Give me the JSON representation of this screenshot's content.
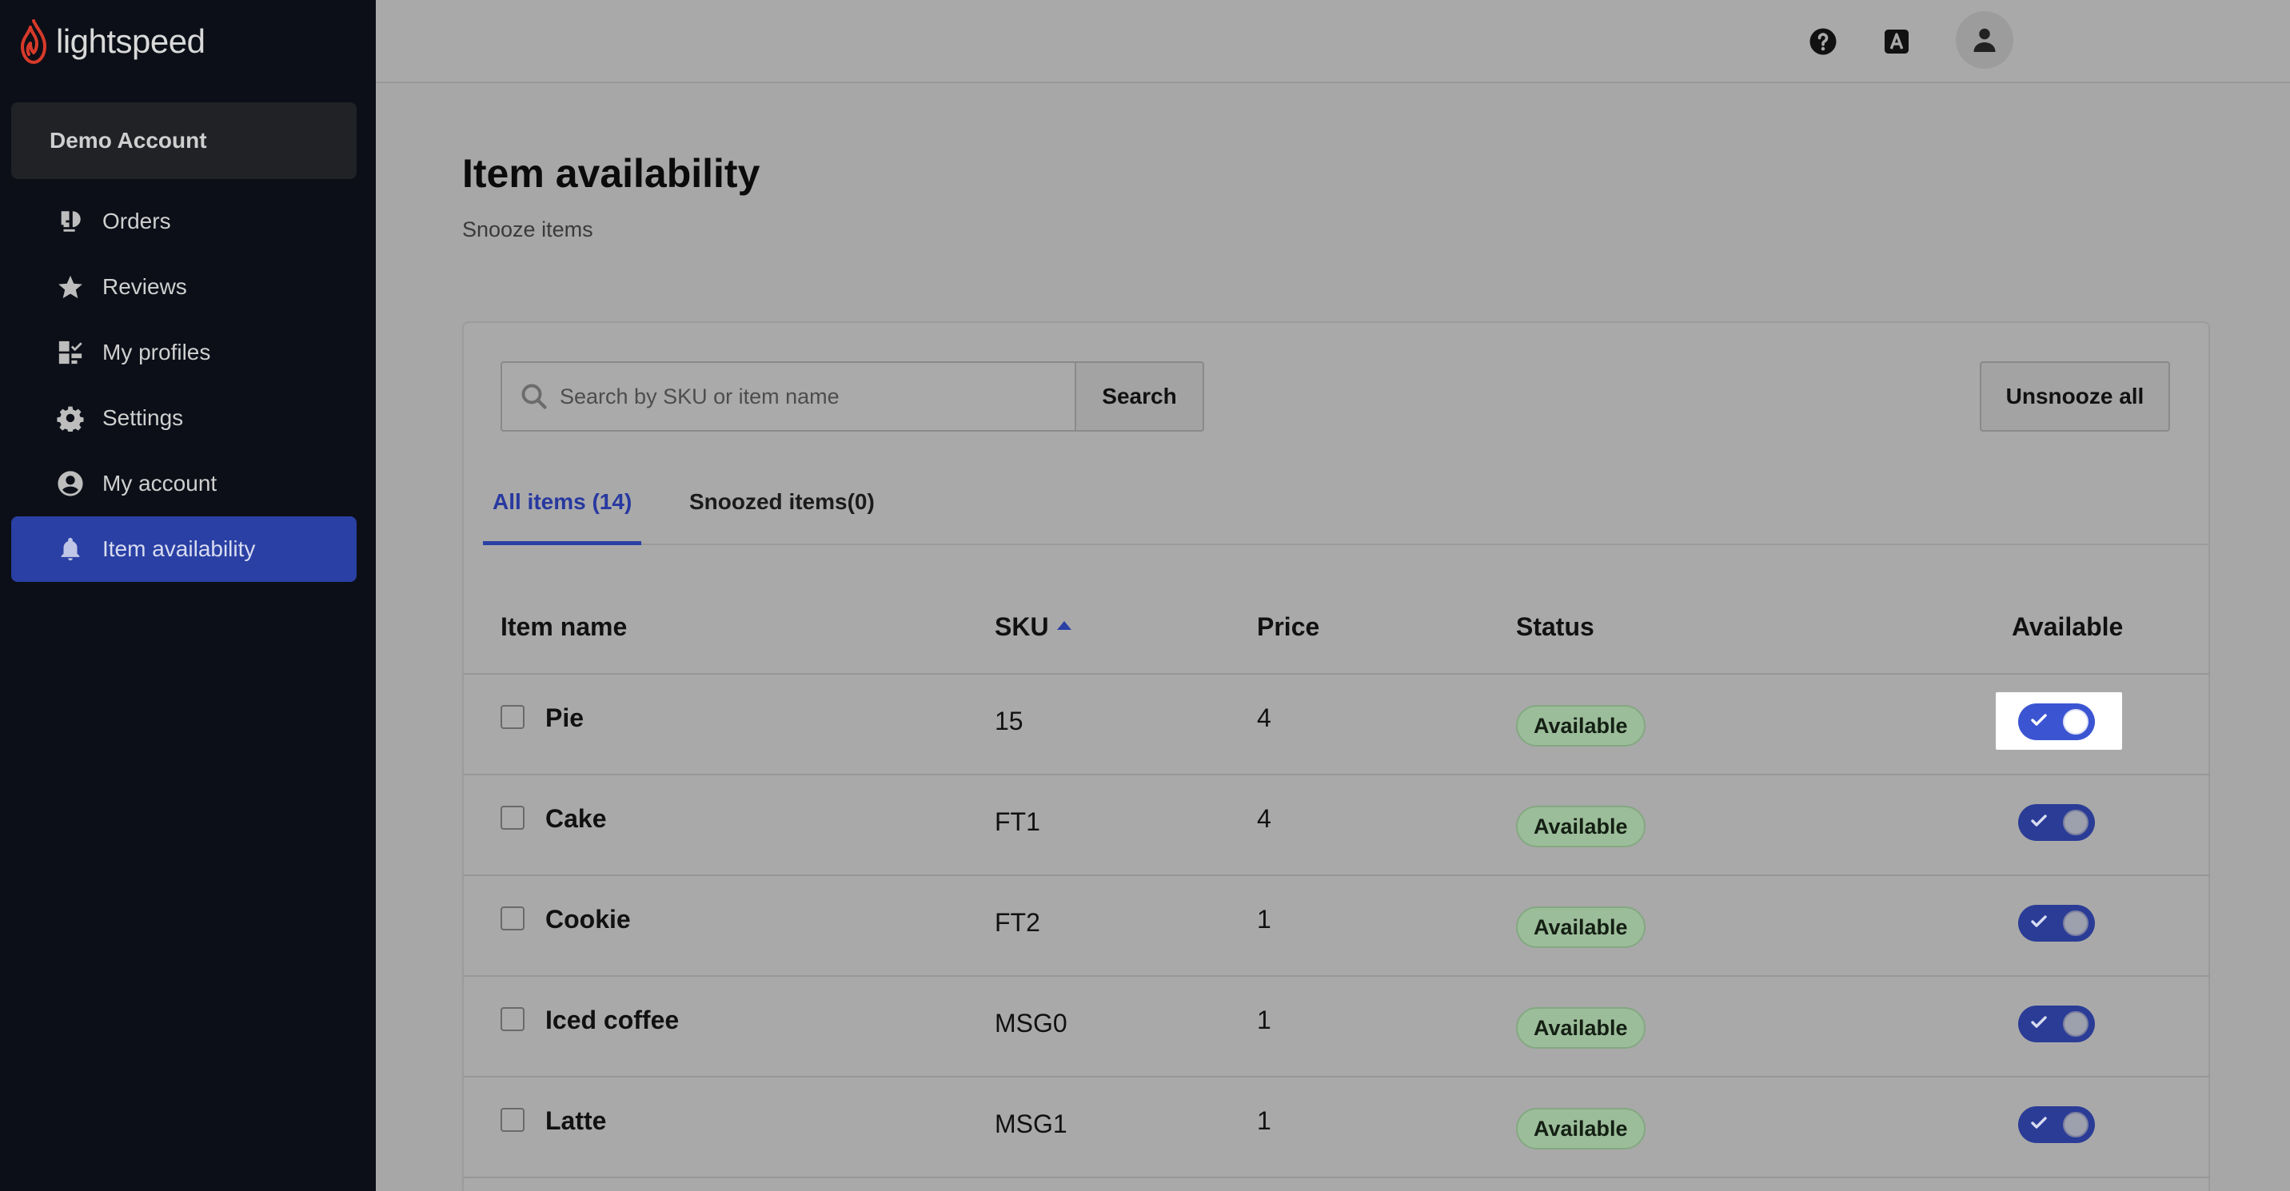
{
  "brand": {
    "name": "lightspeed",
    "accent": "#2a40a4",
    "flame_color": "#d83a2a"
  },
  "sidebar": {
    "account": "Demo Account",
    "items": [
      {
        "label": "Orders",
        "icon": "orders-icon",
        "active": false
      },
      {
        "label": "Reviews",
        "icon": "star-icon",
        "active": false
      },
      {
        "label": "My profiles",
        "icon": "profiles-icon",
        "active": false
      },
      {
        "label": "Settings",
        "icon": "gear-icon",
        "active": false
      },
      {
        "label": "My account",
        "icon": "user-circle-icon",
        "active": false
      },
      {
        "label": "Item availability",
        "icon": "bell-icon",
        "active": true
      }
    ]
  },
  "header": {
    "title": "Item availability",
    "subtitle": "Snooze items"
  },
  "toolbar": {
    "search_placeholder": "Search by SKU or item name",
    "search_label": "Search",
    "unsnooze_label": "Unsnooze all"
  },
  "tabs": [
    {
      "label": "All items (14)",
      "active": true
    },
    {
      "label": "Snoozed items(0)",
      "active": false
    }
  ],
  "table": {
    "columns": {
      "name": "Item name",
      "sku": "SKU",
      "price": "Price",
      "status": "Status",
      "available": "Available"
    },
    "rows": [
      {
        "name": "Pie",
        "sku": "15",
        "price": "4",
        "status": "Available",
        "available": true
      },
      {
        "name": "Cake",
        "sku": "FT1",
        "price": "4",
        "status": "Available",
        "available": true
      },
      {
        "name": "Cookie",
        "sku": "FT2",
        "price": "1",
        "status": "Available",
        "available": true
      },
      {
        "name": "Iced coffee",
        "sku": "MSG0",
        "price": "1",
        "status": "Available",
        "available": true
      },
      {
        "name": "Latte",
        "sku": "MSG1",
        "price": "1",
        "status": "Available",
        "available": true
      }
    ]
  }
}
